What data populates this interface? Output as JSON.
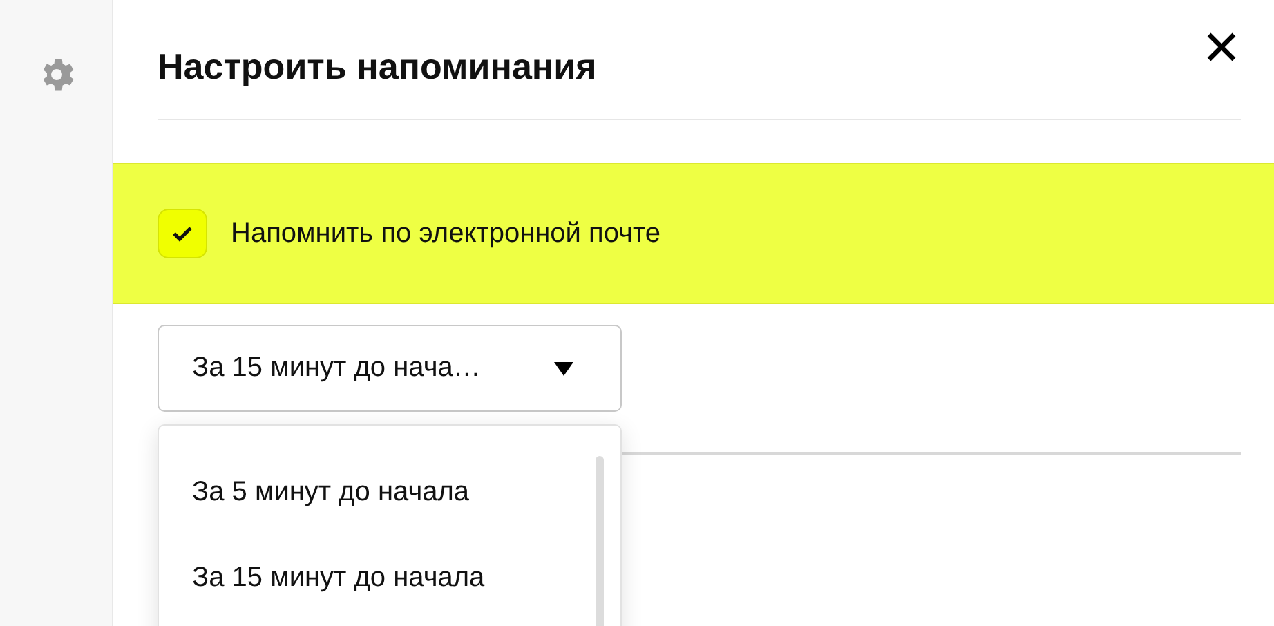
{
  "dialog": {
    "title": "Настроить напоминания"
  },
  "email_reminder": {
    "label": "Напомнить по электронной почте",
    "checked": true
  },
  "reminder_select": {
    "value": "За 15 минут до нача…",
    "expanded": true,
    "options": [
      {
        "label": "За 5 минут до начала",
        "selected": false
      },
      {
        "label": "За 15 минут до начала",
        "selected": false
      }
    ]
  }
}
